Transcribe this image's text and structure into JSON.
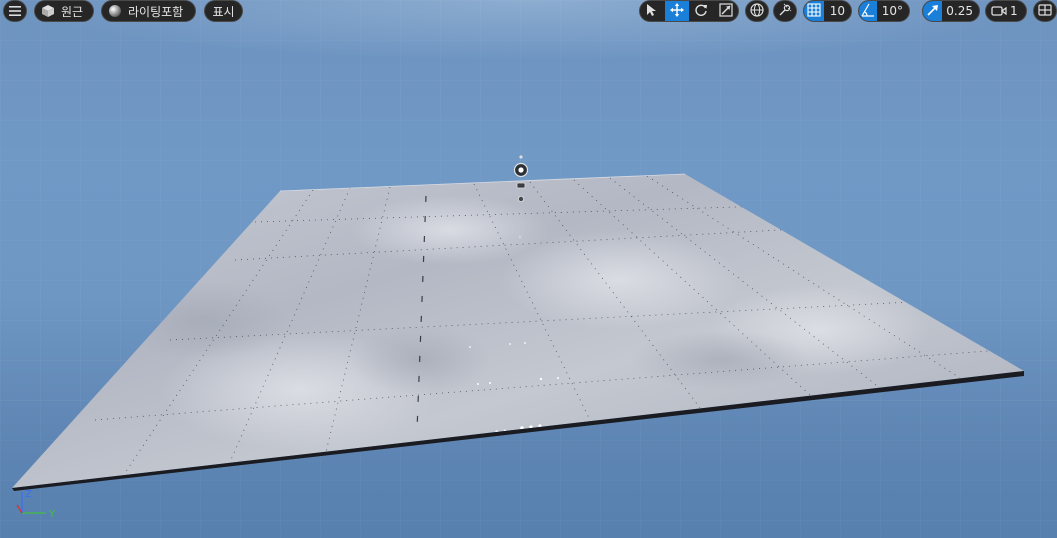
{
  "toolbar": {
    "view_mode": "원근",
    "lighting_mode": "라이팅포함",
    "show_label": "표시",
    "grid_snap_value": "10",
    "rotation_snap_value": "10°",
    "scale_snap_value": "0.25",
    "camera_speed_value": "1",
    "transform_tools": [
      {
        "name": "select-tool",
        "icon": "cursor-icon",
        "active": false
      },
      {
        "name": "translate-tool",
        "icon": "move-arrows-icon",
        "active": true
      },
      {
        "name": "rotate-tool",
        "icon": "rotate-icon",
        "active": false
      },
      {
        "name": "scale-tool",
        "icon": "scale-icon",
        "active": false
      }
    ]
  },
  "axis_gizmo": {
    "z": "Z",
    "y": "Y"
  },
  "colors": {
    "accent": "#1a7fd9",
    "toolbar_bg": "#262626",
    "sky": "#6f97c4",
    "axis_x": "#e03030",
    "axis_y": "#40c040",
    "axis_z": "#3a6ff0"
  }
}
